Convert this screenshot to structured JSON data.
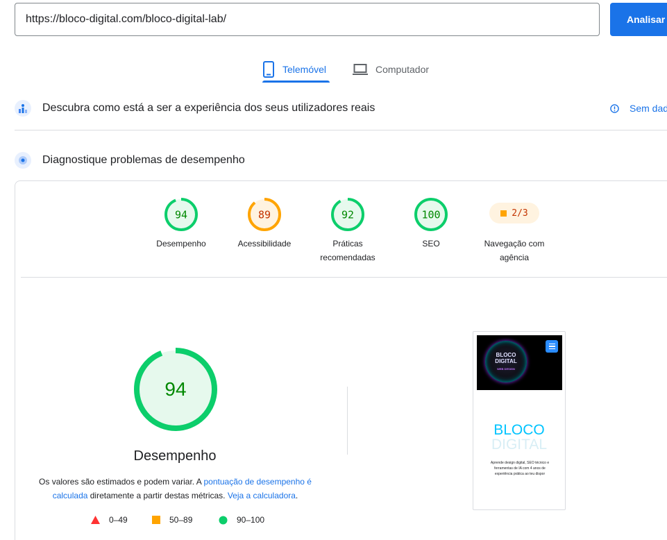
{
  "url_input": {
    "value": "https://bloco-digital.com/bloco-digital-lab/"
  },
  "analyze_label": "Analisar",
  "tabs": [
    {
      "label": "Telemóvel",
      "active": true
    },
    {
      "label": "Computador",
      "active": false
    }
  ],
  "real_users": {
    "title": "Descubra como está a ser a experiência dos seus utilizadores reais",
    "no_data_label": "Sem dad"
  },
  "diagnose": {
    "title": "Diagnostique problemas de desempenho"
  },
  "scores": [
    {
      "label": "Desempenho",
      "value": "94",
      "status": "pass",
      "color": "#0cce6b",
      "text_color": "#008800",
      "fraction": 0.94
    },
    {
      "label": "Acessibilidade",
      "value": "89",
      "status": "average",
      "color": "#ffa400",
      "text_color": "#c33300",
      "fraction": 0.89
    },
    {
      "label": "Práticas recomendadas",
      "value": "92",
      "status": "pass",
      "color": "#0cce6b",
      "text_color": "#008800",
      "fraction": 0.92
    },
    {
      "label": "SEO",
      "value": "100",
      "status": "pass",
      "color": "#0cce6b",
      "text_color": "#008800",
      "fraction": 1.0
    }
  ],
  "pwa": {
    "label": "Navegação com agência",
    "value": "2/3",
    "color": "#ffa400"
  },
  "performance": {
    "value": "94",
    "fraction": 0.94,
    "label": "Desempenho",
    "desc_part1": "Os valores são estimados e podem variar. A ",
    "desc_link1": "pontuação de desempenho é calculada",
    "desc_part2": " diretamente a partir destas métricas. ",
    "desc_link2": "Veja a calculadora",
    "desc_part3": "."
  },
  "legend": [
    {
      "range": "0–49",
      "shape": "triangle",
      "color": "#ff3333"
    },
    {
      "range": "50–89",
      "shape": "square",
      "color": "#ffa400"
    },
    {
      "range": "90–100",
      "shape": "circle",
      "color": "#0cce6b"
    }
  ],
  "screenshot": {
    "logo_line1": "BLOCO",
    "logo_line2": "DIGITAL",
    "logo_sub": "WEB DESIGN",
    "title_line1": "BLOCO",
    "title_line2": "DIGITAL",
    "text": "Aprende design digital, SEO técnico e ferramentas de IA com 4 anos de experiência prática ao teu dispor"
  },
  "colors": {
    "accent": "#1a73e8",
    "pass": "#0cce6b",
    "average": "#ffa400",
    "fail": "#ff3333"
  }
}
